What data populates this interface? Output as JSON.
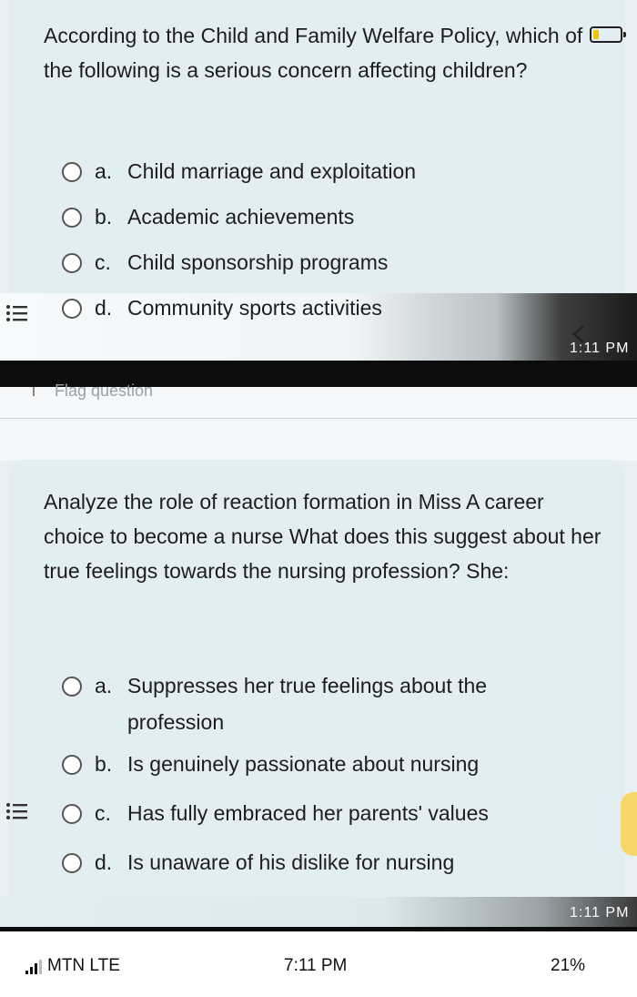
{
  "question1": {
    "text": "According to the Child and Family Welfare Policy, which of the following is a serious concern affecting children?",
    "options": [
      {
        "letter": "a.",
        "text": "Child marriage and exploitation"
      },
      {
        "letter": "b.",
        "text": "Academic achievements"
      },
      {
        "letter": "c.",
        "text": "Child sponsorship programs"
      },
      {
        "letter": "d.",
        "text": "Community sports activities"
      }
    ],
    "timestamp": "1:11 PM"
  },
  "flag": {
    "label": "Flag question"
  },
  "question2": {
    "text": "Analyze the role of reaction formation in Miss A career choice to become a nurse What does this suggest about her true feelings towards the nursing profession? She:",
    "options": [
      {
        "letter": "a.",
        "text": "Suppresses her true feelings about the profession"
      },
      {
        "letter": "b.",
        "text": "Is genuinely passionate about nursing"
      },
      {
        "letter": "c.",
        "text": "Has fully embraced her parents' values"
      },
      {
        "letter": "d.",
        "text": "Is unaware of his dislike for nursing"
      }
    ],
    "timestamp": "1:11 PM"
  },
  "status_bar": {
    "carrier": "MTN  LTE",
    "time": "7:11 PM",
    "battery": "21%",
    "battery_level": 0.21
  },
  "icons": [
    "list-icon",
    "back-chevron-icon",
    "radio-icon",
    "signal-icon",
    "battery-icon"
  ]
}
